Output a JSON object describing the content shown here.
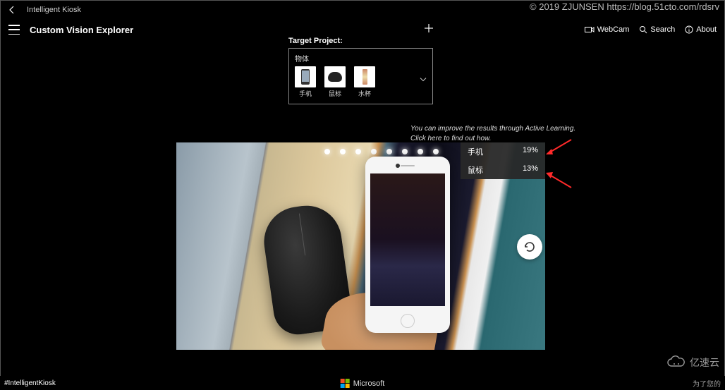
{
  "watermark": "© 2019 ZJUNSEN https://blog.51cto.com/rdsrv",
  "titlebar": {
    "app_name": "Intelligent Kiosk"
  },
  "header": {
    "page_title": "Custom Vision Explorer",
    "webcam": "WebCam",
    "search": "Search",
    "about": "About"
  },
  "target": {
    "label": "Target Project:",
    "group": "物体",
    "items": [
      {
        "label": "手机"
      },
      {
        "label": "鼠标"
      },
      {
        "label": "水杯"
      }
    ]
  },
  "hint": {
    "line1": "You can improve the results through Active Learning.",
    "line2": "Click here to find out how."
  },
  "results": [
    {
      "label": "手机",
      "score": "19%"
    },
    {
      "label": "鼠标",
      "score": "13%"
    }
  ],
  "footer": {
    "hashtag": "#IntelligentKiosk",
    "vendor": "Microsoft",
    "right_text": "为了您的"
  },
  "brand": "亿速云"
}
